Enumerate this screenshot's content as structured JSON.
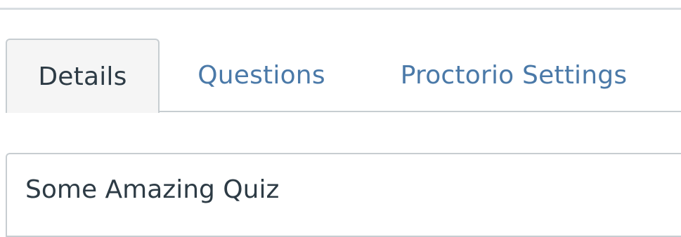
{
  "tabs": [
    {
      "label": "Details",
      "active": true
    },
    {
      "label": "Questions",
      "active": false
    },
    {
      "label": "Proctorio Settings",
      "active": false
    }
  ],
  "quiz": {
    "title_value": "Some Amazing Quiz"
  },
  "colors": {
    "link": "#4a79a8",
    "text": "#2d3b45",
    "border": "#c7cdd1",
    "active_tab_bg": "#f5f5f5"
  }
}
